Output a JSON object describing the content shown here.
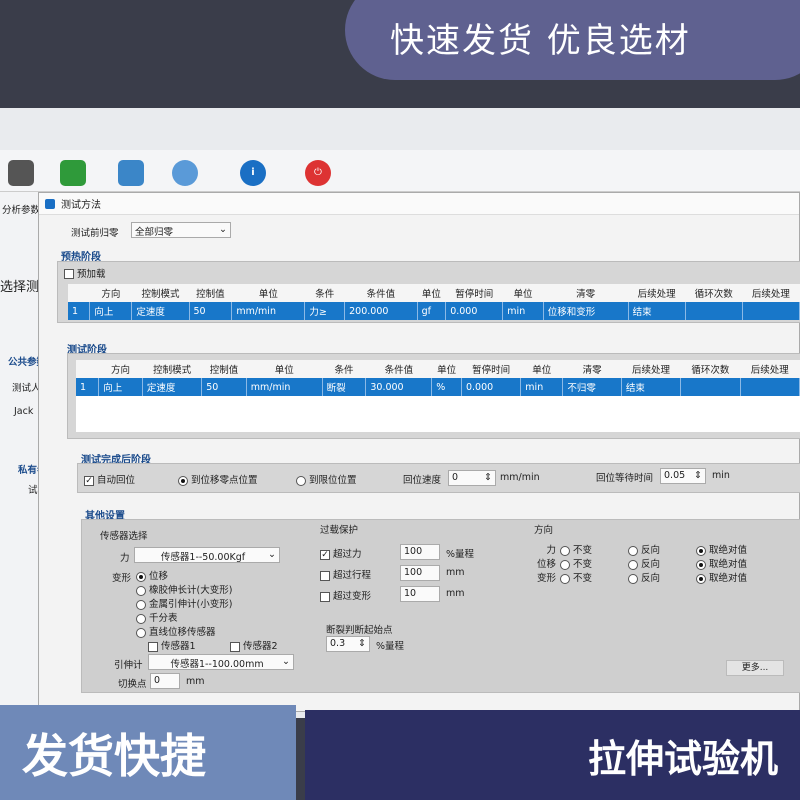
{
  "banners": {
    "top": "快速发货 优良选材",
    "bottom_left": "发货快捷",
    "bottom_right": "拉伸试验机"
  },
  "background_window": {
    "tab": "分析参数",
    "select_test": "选择测试",
    "public_params": "公共参数",
    "tester_header": "测试人员",
    "tester": "Jack",
    "private_params": "私有参数",
    "sample_count": "试样个数"
  },
  "dialog": {
    "title": "测试方法",
    "zero_label": "测试前归零",
    "zero_value": "全部归零",
    "preheat": {
      "title": "预热阶段",
      "preload_label": "预加载",
      "preload_checked": false,
      "columns": [
        "",
        "方向",
        "控制模式",
        "控制值",
        "单位",
        "条件",
        "条件值",
        "单位",
        "暂停时间",
        "单位",
        "清零",
        "后续处理",
        "循环次数",
        "后续处理"
      ],
      "rows": [
        [
          "1",
          "向上",
          "定速度",
          "50",
          "mm/min",
          "力≥",
          "200.000",
          "gf",
          "0.000",
          "min",
          "位移和变形",
          "结束",
          "",
          ""
        ]
      ]
    },
    "test": {
      "title": "测试阶段",
      "columns": [
        "",
        "方向",
        "控制模式",
        "控制值",
        "单位",
        "条件",
        "条件值",
        "单位",
        "暂停时间",
        "单位",
        "清零",
        "后续处理",
        "循环次数",
        "后续处理"
      ],
      "rows": [
        [
          "1",
          "向上",
          "定速度",
          "50",
          "mm/min",
          "断裂",
          "30.000",
          "%",
          "0.000",
          "min",
          "不归零",
          "结束",
          "",
          ""
        ]
      ]
    },
    "after": {
      "title": "测试完成后阶段",
      "auto_return": "自动回位",
      "auto_return_checked": true,
      "to_zero": "到位移零点位置",
      "to_limit": "到限位位置",
      "selected": "到位移零点位置",
      "return_speed_label": "回位速度",
      "return_speed": "0",
      "return_speed_unit": "mm/min",
      "wait_label": "回位等待时间",
      "wait": "0.05",
      "wait_unit": "min"
    },
    "other": {
      "title": "其他设置",
      "sensor_title": "传感器选择",
      "force_label": "力",
      "force_sensor": "传感器1--50.00Kgf",
      "deform_label": "变形",
      "deform_options": [
        "位移",
        "橡胶伸长计(大变形)",
        "金属引伸计(小变形)",
        "千分表",
        "直线位移传感器"
      ],
      "deform_selected": "位移",
      "sensor1": "传感器1",
      "sensor2": "传感器2",
      "extensometer_label": "引伸计",
      "extensometer": "传感器1--100.00mm",
      "switch_label": "切换点",
      "switch_value": "0",
      "switch_unit": "mm",
      "overload_title": "过载保护",
      "overload": [
        {
          "label": "超过力",
          "checked": true,
          "value": "100",
          "unit": "%量程"
        },
        {
          "label": "超过行程",
          "checked": false,
          "value": "100",
          "unit": "mm"
        },
        {
          "label": "超过变形",
          "checked": false,
          "value": "10",
          "unit": "mm"
        }
      ],
      "break_label": "断裂判断起始点",
      "break_value": "0.3",
      "break_unit": "%量程",
      "direction_title": "方向",
      "direction_rows": [
        {
          "label": "力"
        },
        {
          "label": "位移"
        },
        {
          "label": "变形"
        }
      ],
      "direction_options": [
        "不变",
        "反向",
        "取绝对值"
      ],
      "direction_selected": "取绝对值",
      "more_button": "更多..."
    }
  }
}
